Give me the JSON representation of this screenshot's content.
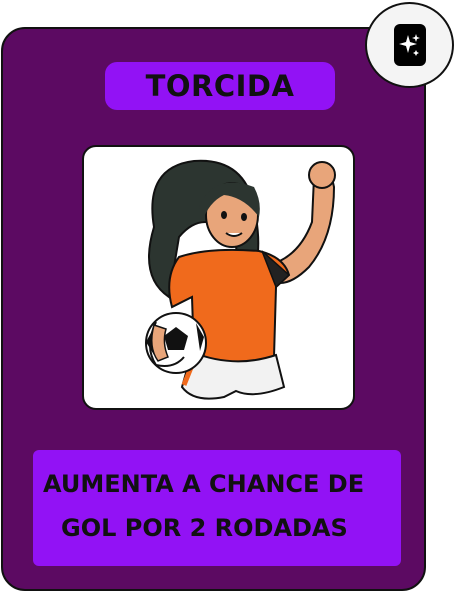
{
  "card": {
    "title": "TORCIDA",
    "description_line1": "AUMENTA A CHANCE DE",
    "description_line2": "GOL POR 2 RODADAS",
    "image_icon": "soccer-player-woman-illustration",
    "badge_icon": "sparkles-card-icon"
  },
  "colors": {
    "card_background": "#5c0a62",
    "accent": "#9212f5",
    "jersey": "#f06a1c"
  }
}
